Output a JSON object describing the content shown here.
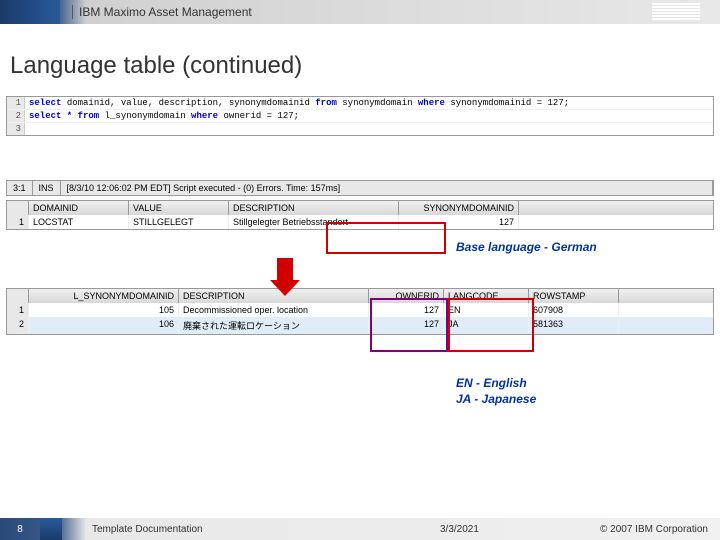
{
  "header": {
    "product": "IBM Maximo Asset Management",
    "logo": "IBM"
  },
  "title": "Language table (continued)",
  "sql": {
    "lines": [
      {
        "n": "1",
        "pre": "select ",
        "mid": "domainid, value, description, synonymdomainid ",
        "kw2": "from ",
        "mid2": "synonymdomain ",
        "kw3": "where ",
        "post": "synonymdomainid = 127;"
      },
      {
        "n": "2",
        "pre": "select * from ",
        "mid": "l_synonymdomain ",
        "kw2": "where ",
        "mid2": "ownerid = 127;",
        "kw3": "",
        "post": ""
      },
      {
        "n": "3",
        "pre": "",
        "mid": "",
        "kw2": "",
        "mid2": "",
        "kw3": "",
        "post": ""
      }
    ]
  },
  "status": {
    "a": "3:1",
    "b": "INS",
    "c": "[8/3/10 12:06:02 PM EDT] Script executed - (0) Errors. Time: 157ms]"
  },
  "grid1": {
    "headers": [
      "DOMAINID",
      "VALUE",
      "DESCRIPTION",
      "SYNONYMDOMAINID"
    ],
    "rows": [
      {
        "n": "1",
        "domain": "LOCSTAT",
        "value": "STILLGELEGT",
        "desc": "Stillgelegter Betriebsstandort",
        "syn": "127"
      }
    ]
  },
  "grid2": {
    "headers": [
      "L_SYNONYMDOMAINID",
      "DESCRIPTION",
      "OWNERID",
      "LANGCODE",
      "ROWSTAMP"
    ],
    "rows": [
      {
        "n": "1",
        "syn": "105",
        "desc": "Decommissioned oper. location",
        "own": "127",
        "lang": "EN",
        "row": "607908"
      },
      {
        "n": "2",
        "syn": "106",
        "desc": "廃棄された運転ロケーション",
        "own": "127",
        "lang": "JA",
        "row": "581363"
      }
    ]
  },
  "callouts": {
    "base": "Base language - German",
    "en": "EN - English",
    "ja": "JA - Japanese"
  },
  "footer": {
    "page": "8",
    "doc": "Template Documentation",
    "date": "3/3/2021",
    "corp": "© 2007 IBM Corporation"
  }
}
